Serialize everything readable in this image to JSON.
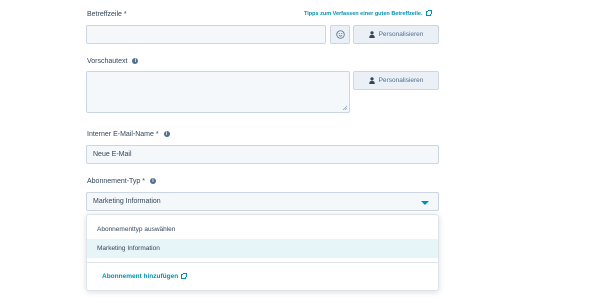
{
  "subject": {
    "label": "Betreffzeile *",
    "tips_link": "Tipps zum Verfassen einer guten Betreffzeile.",
    "value": "",
    "emoji_button_icon": "smiley-icon",
    "personalize_label": "Personalisieren",
    "personalize_icon": "person-icon"
  },
  "preview": {
    "label": "Vorschautext",
    "value": "",
    "personalize_label": "Personalisieren",
    "personalize_icon": "person-icon"
  },
  "internal_name": {
    "label": "Interner E-Mail-Name *",
    "value": "Neue E-Mail"
  },
  "subscription": {
    "label": "Abonnement-Typ *",
    "selected": "Marketing Information",
    "options": [
      "Abonnementtyp auswählen",
      "Marketing Information"
    ],
    "selected_index": 1,
    "add_link": "Abonnement hinzufügen"
  },
  "colors": {
    "accent": "#0091ae",
    "text": "#33475b",
    "field_bg": "#f5f8fa",
    "border": "#cbd6e2",
    "selected_bg": "#e5f5f8"
  }
}
